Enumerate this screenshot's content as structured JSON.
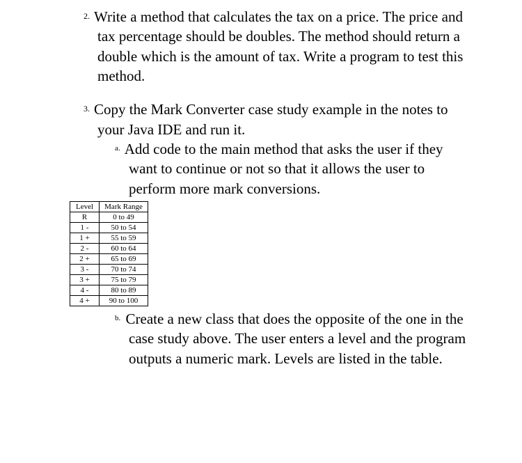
{
  "items": {
    "item2": {
      "number": "2.",
      "text": "Write a method that calculates the tax on a price. The price and tax percentage should be doubles.  The method should return a double which is the amount of tax. Write a program to test this method."
    },
    "item3": {
      "number": "3.",
      "text": "Copy the Mark Converter case study example in the notes to your Java IDE and run it.",
      "sub_a": {
        "number": "a.",
        "text": "Add code to the main method that asks the user if they want to continue or not so that it allows the user to perform more mark conversions."
      },
      "sub_b": {
        "number": "b.",
        "text": "Create a new class that does the opposite of the one in the case study above. The user enters a level and the program outputs a numeric mark. Levels are listed in the table."
      }
    }
  },
  "table": {
    "headers": {
      "col1": "Level",
      "col2": "Mark Range"
    },
    "rows": [
      {
        "level": "R",
        "range": "0 to 49"
      },
      {
        "level": "1 -",
        "range": "50 to 54"
      },
      {
        "level": "1 +",
        "range": "55 to 59"
      },
      {
        "level": "2 -",
        "range": "60 to 64"
      },
      {
        "level": "2 +",
        "range": "65 to 69"
      },
      {
        "level": "3 -",
        "range": "70 to 74"
      },
      {
        "level": "3 +",
        "range": "75 to 79"
      },
      {
        "level": "4 -",
        "range": "80 to 89"
      },
      {
        "level": "4 +",
        "range": "90 to 100"
      }
    ]
  }
}
